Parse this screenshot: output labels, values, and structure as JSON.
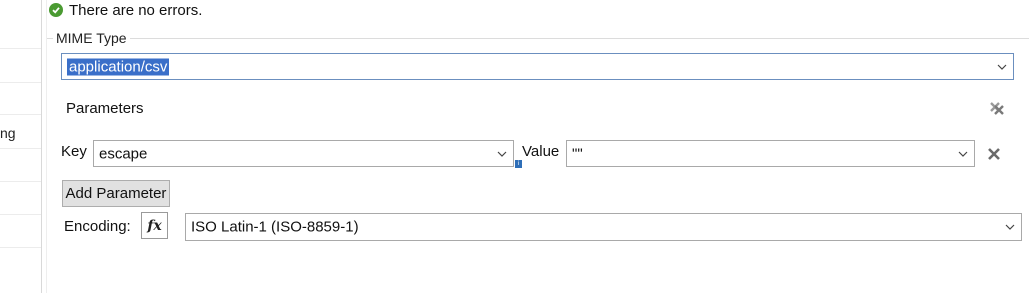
{
  "status": {
    "text": "There are no errors.",
    "icon": "check-circle-icon",
    "color": "#4a9a32"
  },
  "left_panel": {
    "partial_label": "ng"
  },
  "mime_group": {
    "legend": "MIME Type",
    "mime_type_value": "application/csv",
    "parameters_label": "Parameters",
    "parameter": {
      "key_label": "Key",
      "key_value": "escape",
      "value_label": "Value",
      "value_value": "\"\""
    },
    "add_parameter_label": "Add Parameter",
    "encoding_label": "Encoding:",
    "fx_label": "fx",
    "encoding_value": "ISO Latin-1 (ISO-8859-1)"
  },
  "colors": {
    "selection": "#3a6fc9",
    "focus_border": "#6b8fbf"
  }
}
